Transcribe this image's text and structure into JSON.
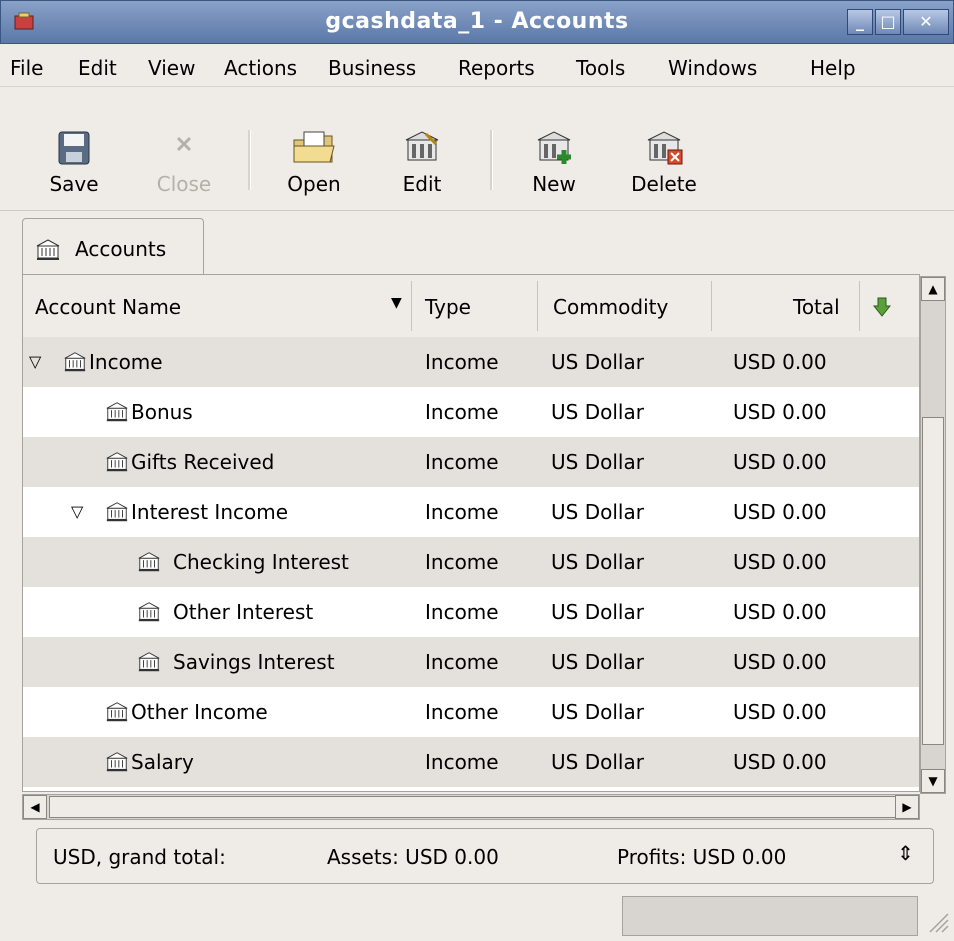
{
  "window": {
    "title": "gcashdata_1 - Accounts"
  },
  "menu": [
    "File",
    "Edit",
    "View",
    "Actions",
    "Business",
    "Reports",
    "Tools",
    "Windows",
    "Help"
  ],
  "toolbar": {
    "save": "Save",
    "close": "Close",
    "open": "Open",
    "edit": "Edit",
    "new": "New",
    "delete": "Delete"
  },
  "tab": {
    "label": "Accounts"
  },
  "columns": {
    "account_name": "Account Name",
    "type": "Type",
    "commodity": "Commodity",
    "total": "Total"
  },
  "rows": [
    {
      "name": "Income",
      "type": "Income",
      "commodity": "US Dollar",
      "total": "USD 0.00"
    },
    {
      "name": "Bonus",
      "type": "Income",
      "commodity": "US Dollar",
      "total": "USD 0.00"
    },
    {
      "name": "Gifts Received",
      "type": "Income",
      "commodity": "US Dollar",
      "total": "USD 0.00"
    },
    {
      "name": "Interest Income",
      "type": "Income",
      "commodity": "US Dollar",
      "total": "USD 0.00"
    },
    {
      "name": "Checking Interest",
      "type": "Income",
      "commodity": "US Dollar",
      "total": "USD 0.00"
    },
    {
      "name": "Other Interest",
      "type": "Income",
      "commodity": "US Dollar",
      "total": "USD 0.00"
    },
    {
      "name": "Savings Interest",
      "type": "Income",
      "commodity": "US Dollar",
      "total": "USD 0.00"
    },
    {
      "name": "Other Income",
      "type": "Income",
      "commodity": "US Dollar",
      "total": "USD 0.00"
    },
    {
      "name": "Salary",
      "type": "Income",
      "commodity": "US Dollar",
      "total": "USD 0.00"
    }
  ],
  "summary": {
    "label": "USD, grand total:",
    "assets": "Assets: USD 0.00",
    "profits": "Profits: USD 0.00"
  },
  "colors": {
    "titlebar": "#6a86b6",
    "row_alt": "#e4e0dc",
    "window_bg": "#efebe7"
  }
}
